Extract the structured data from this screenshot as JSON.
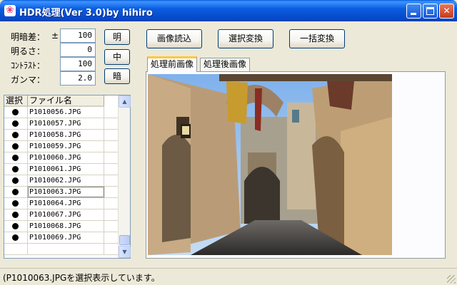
{
  "window": {
    "title": "HDR処理(Ver 3.0)by hihiro"
  },
  "params": [
    {
      "label": "明暗差：",
      "prefix": "±",
      "value": "100"
    },
    {
      "label": "明るさ：",
      "prefix": "",
      "value": "0"
    },
    {
      "label": "ｺﾝﾄﾗｽﾄ：",
      "prefix": "",
      "value": "100"
    },
    {
      "label": "ガンマ：",
      "prefix": "",
      "value": "2.0"
    }
  ],
  "level_buttons": {
    "bright": "明",
    "mid": "中",
    "dark": "暗"
  },
  "toolbar": {
    "load": "画像読込",
    "convert_selected": "選択変換",
    "convert_all": "一括変換"
  },
  "file_list": {
    "headers": {
      "select": "選択",
      "filename": "ファイル名"
    },
    "rows": [
      {
        "selected": true,
        "name": "P1010056.JPG"
      },
      {
        "selected": true,
        "name": "P1010057.JPG"
      },
      {
        "selected": true,
        "name": "P1010058.JPG"
      },
      {
        "selected": true,
        "name": "P1010059.JPG"
      },
      {
        "selected": true,
        "name": "P1010060.JPG"
      },
      {
        "selected": true,
        "name": "P1010061.JPG"
      },
      {
        "selected": true,
        "name": "P1010062.JPG"
      },
      {
        "selected": true,
        "name": "P1010063.JPG",
        "current": true
      },
      {
        "selected": true,
        "name": "P1010064.JPG"
      },
      {
        "selected": true,
        "name": "P1010067.JPG"
      },
      {
        "selected": true,
        "name": "P1010068.JPG"
      },
      {
        "selected": true,
        "name": "P1010069.JPG"
      },
      {
        "selected": false,
        "name": ""
      }
    ]
  },
  "tabs": [
    {
      "label": "処理前画像",
      "active": true
    },
    {
      "label": "処理後画像",
      "active": false
    }
  ],
  "status": {
    "text": "(P1010063.JPGを選択表示しています。"
  },
  "icons": {
    "app": "app-icon",
    "minimize": "minimize-icon",
    "maximize": "maximize-icon",
    "close": "close-icon"
  },
  "colors": {
    "titlebar": "#0c5de0",
    "tab_highlight": "#ffc83c",
    "window_bg": "#ece9d8"
  }
}
